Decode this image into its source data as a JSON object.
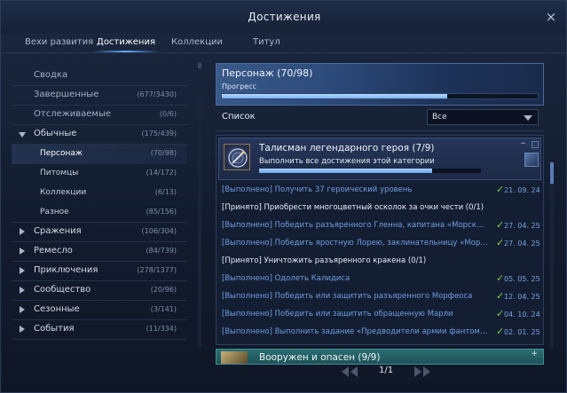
{
  "window": {
    "title": "Достижения",
    "close": "×"
  },
  "tabs": [
    {
      "label": "Вехи развития",
      "active": false
    },
    {
      "label": "Достижения",
      "active": true
    },
    {
      "label": "Коллекции",
      "active": false
    },
    {
      "label": "Титул",
      "active": false
    }
  ],
  "sidebar": {
    "items": [
      {
        "label": "Сводка",
        "count": "",
        "kind": "top"
      },
      {
        "label": "Завершенные",
        "count": "(677/3430)",
        "kind": "top"
      },
      {
        "label": "Отслеживаемые",
        "count": "(0/6)",
        "kind": "top"
      },
      {
        "label": "Обычные",
        "count": "(175/439)",
        "kind": "cat",
        "expanded": true
      },
      {
        "label": "Персонаж",
        "count": "(70/98)",
        "kind": "sub",
        "selected": true
      },
      {
        "label": "Питомцы",
        "count": "(14/172)",
        "kind": "sub"
      },
      {
        "label": "Коллекции",
        "count": "(6/13)",
        "kind": "sub"
      },
      {
        "label": "Разное",
        "count": "(85/156)",
        "kind": "sub"
      },
      {
        "label": "Сражения",
        "count": "(106/304)",
        "kind": "cat"
      },
      {
        "label": "Ремесло",
        "count": "(84/739)",
        "kind": "cat"
      },
      {
        "label": "Приключения",
        "count": "(278/1377)",
        "kind": "cat"
      },
      {
        "label": "Сообщество",
        "count": "(20/96)",
        "kind": "cat"
      },
      {
        "label": "Сезонные",
        "count": "(3/141)",
        "kind": "cat"
      },
      {
        "label": "События",
        "count": "(11/334)",
        "kind": "cat"
      }
    ]
  },
  "header": {
    "title": "Персонаж (70/98)",
    "progress_label": "Прогресс",
    "progress": 0.714
  },
  "list": {
    "label": "Список",
    "filter_value": "Все"
  },
  "achievement": {
    "name": "Талисман легендарного героя (7/9)",
    "description": "Выполнить все достижения этой категории",
    "progress": 0.778,
    "minus": "–",
    "rows": [
      {
        "text": "[Выполнено] Получить 37 героический уровень",
        "status": "done",
        "check": "✓",
        "date": "21. 09. 24"
      },
      {
        "text": "[Принято] Приобрести многоцветный осколок за очки чести (0/1)",
        "status": "taken",
        "check": "",
        "date": ""
      },
      {
        "text": "[Выполнено] Победить разъяренного Гленна, капитана «Морского дра...",
        "status": "done",
        "check": "✓",
        "date": "27. 04. 25"
      },
      {
        "text": "[Выполнено] Победить яростную Лорею, заклинательницу «Морского ...",
        "status": "done",
        "check": "✓",
        "date": "27. 04. 25"
      },
      {
        "text": "[Принято] Уничтожить разъяренного кракена (0/1)",
        "status": "taken",
        "check": "",
        "date": ""
      },
      {
        "text": "[Выполнено] Одолеть Калидиса",
        "status": "done",
        "check": "✓",
        "date": "05. 05. 25"
      },
      {
        "text": "[Выполнено] Победить или защитить разъяренного Морфеоса",
        "status": "done",
        "check": "✓",
        "date": "12. 04. 25"
      },
      {
        "text": "[Выполнено] Победить или защитить обращенную Марли",
        "status": "done",
        "check": "✓",
        "date": "04. 10. 24"
      },
      {
        "text": "[Выполнено] Выполнить задание «Предводители армии фантомов»",
        "status": "done",
        "check": "✓",
        "date": "02. 01. 25"
      }
    ]
  },
  "next_achievement": {
    "name": "Вооружен и опасен (9/9)",
    "plus": "+"
  },
  "pager": {
    "page": "1/1"
  },
  "colors": {
    "accent": "#5fa9ff",
    "done_text": "#6f9fe0",
    "check_green": "#7bd24a",
    "header_blue": "#2c4a7a"
  }
}
